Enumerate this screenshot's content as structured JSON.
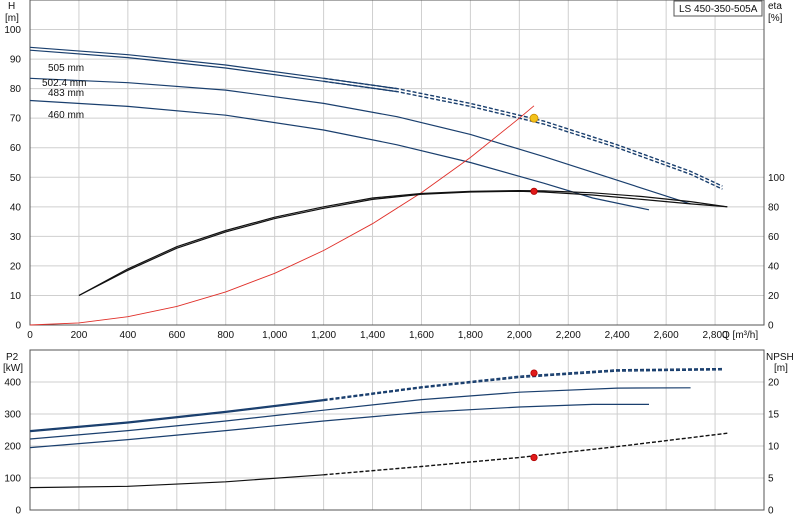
{
  "model_label": "LS 450-350-505A",
  "chart_data": [
    {
      "type": "line",
      "title": "",
      "axes": {
        "x": {
          "label": "Q [m³/h]",
          "min": 0,
          "max": 3000,
          "ticks": [
            "0",
            "200",
            "400",
            "600",
            "800",
            "1,000",
            "1,200",
            "1,400",
            "1,600",
            "1,800",
            "2,000",
            "2,200",
            "2,400",
            "2,600",
            "2,800"
          ]
        },
        "y_left": {
          "label": "H",
          "unit": "[m]",
          "min": 0,
          "max": 110,
          "ticks": [
            "0",
            "10",
            "20",
            "30",
            "40",
            "50",
            "60",
            "70",
            "80",
            "90",
            "100"
          ]
        },
        "y_right": {
          "label": "eta",
          "unit": "[%]",
          "min": 0,
          "max": 220,
          "ticks": [
            "0",
            "20",
            "40",
            "60",
            "80",
            "100"
          ]
        }
      },
      "grid": true,
      "series": [
        {
          "name": "505 mm",
          "axis": "left",
          "color": "#1a3f6e",
          "dashed_from": 1500,
          "x": [
            0,
            400,
            800,
            1200,
            1500,
            1800,
            2100,
            2400,
            2700,
            2830
          ],
          "y": [
            94,
            91.5,
            88,
            83.5,
            80,
            75,
            69,
            61,
            52,
            47
          ]
        },
        {
          "name": "502.4 mm",
          "axis": "left",
          "color": "#1a3f6e",
          "dashed_from": 1500,
          "x": [
            0,
            400,
            800,
            1200,
            1500,
            1800,
            2100,
            2400,
            2700,
            2830
          ],
          "y": [
            93,
            90.5,
            87,
            82.5,
            79,
            74,
            68,
            60,
            51,
            46
          ]
        },
        {
          "name": "483 mm",
          "axis": "left",
          "color": "#1a3f6e",
          "x": [
            0,
            400,
            800,
            1200,
            1500,
            1800,
            2100,
            2400,
            2700
          ],
          "y": [
            83.5,
            82,
            79.5,
            75,
            70.5,
            64.5,
            57,
            49,
            41
          ]
        },
        {
          "name": "460 mm",
          "axis": "left",
          "color": "#1a3f6e",
          "x": [
            0,
            400,
            800,
            1200,
            1500,
            1800,
            2100,
            2300,
            2530
          ],
          "y": [
            76,
            74,
            71,
            66,
            61,
            55,
            48,
            43,
            39
          ]
        },
        {
          "name": "",
          "axis": "left",
          "color": "#e0302a",
          "x": [
            0,
            200,
            400,
            600,
            800,
            1000,
            1200,
            1400,
            1600,
            1800,
            2000,
            2060
          ],
          "y": [
            0,
            0.7,
            2.8,
            6.3,
            11.2,
            17.5,
            25.2,
            34.3,
            44.8,
            56.7,
            70,
            74.2
          ]
        },
        {
          "name": "",
          "axis": "right",
          "color": "#111111",
          "x": [
            200,
            400,
            600,
            800,
            1000,
            1200,
            1400,
            1600,
            1800,
            2000,
            2100,
            2300,
            2500,
            2700,
            2850
          ],
          "y": [
            20,
            37,
            52,
            63,
            72,
            79,
            85,
            88.5,
            90,
            90.5,
            90,
            88,
            85,
            82,
            80
          ]
        },
        {
          "name": "",
          "axis": "right",
          "color": "#111111",
          "x": [
            200,
            400,
            600,
            800,
            1000,
            1200,
            1400,
            1600,
            1800,
            2000,
            2100,
            2300,
            2500,
            2700,
            2850
          ],
          "y": [
            20,
            38,
            53,
            64,
            73,
            80,
            86,
            89,
            90.5,
            91,
            90.8,
            89.5,
            87,
            83.5,
            80
          ]
        }
      ],
      "points": [
        {
          "x": 2060,
          "y": 70,
          "axis": "left",
          "color": "#f2c21a"
        },
        {
          "x": 2060,
          "y": 90.5,
          "axis": "right",
          "color": "#e01a1a"
        }
      ]
    },
    {
      "type": "line",
      "title": "",
      "axes": {
        "x": {
          "min": 0,
          "max": 3000
        },
        "y_left": {
          "label": "P2",
          "unit": "[kW]",
          "min": 0,
          "max": 500,
          "ticks": [
            "0",
            "100",
            "200",
            "300",
            "400"
          ]
        },
        "y_right": {
          "label": "NPSH",
          "unit": "[m]",
          "min": 0,
          "max": 25,
          "ticks": [
            "0",
            "5",
            "10",
            "15",
            "20"
          ]
        }
      },
      "grid": true,
      "series": [
        {
          "name": "",
          "axis": "left",
          "color": "#1a3f6e",
          "dashed_from": 1500,
          "x": [
            0,
            400,
            800,
            1200,
            1600,
            2000,
            2400,
            2830
          ],
          "y": [
            248,
            275,
            308,
            345,
            385,
            418,
            438,
            442
          ]
        },
        {
          "name": "",
          "axis": "left",
          "color": "#1a3f6e",
          "dashed_from": 1500,
          "x": [
            0,
            400,
            800,
            1200,
            1600,
            2000,
            2400,
            2830
          ],
          "y": [
            245,
            272,
            305,
            342,
            382,
            414,
            434,
            438
          ]
        },
        {
          "name": "",
          "axis": "left",
          "color": "#1a3f6e",
          "x": [
            0,
            400,
            800,
            1200,
            1600,
            2000,
            2400,
            2700
          ],
          "y": [
            222,
            248,
            278,
            312,
            345,
            368,
            381,
            382
          ]
        },
        {
          "name": "",
          "axis": "left",
          "color": "#1a3f6e",
          "x": [
            0,
            400,
            800,
            1200,
            1600,
            2000,
            2300,
            2530
          ],
          "y": [
            195,
            220,
            248,
            278,
            305,
            322,
            330,
            330
          ]
        },
        {
          "name": "",
          "axis": "right",
          "color": "#111111",
          "dashed_from": 1500,
          "x": [
            0,
            400,
            800,
            1200,
            1600,
            2000,
            2400,
            2850
          ],
          "y": [
            3.5,
            3.7,
            4.4,
            5.5,
            6.8,
            8.2,
            9.9,
            12
          ]
        }
      ],
      "points": [
        {
          "x": 2060,
          "y": 428,
          "axis": "left",
          "color": "#e01a1a"
        },
        {
          "x": 2060,
          "y": 8.2,
          "axis": "right",
          "color": "#e01a1a"
        }
      ]
    }
  ]
}
